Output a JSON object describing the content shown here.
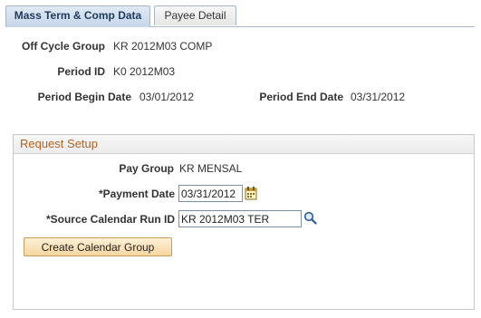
{
  "tabs": [
    {
      "label": "Mass Term & Comp Data",
      "active": true
    },
    {
      "label": "Payee Detail",
      "active": false
    }
  ],
  "header": {
    "off_cycle_group_label": "Off Cycle Group",
    "off_cycle_group_value": "KR 2012M03 COMP",
    "period_id_label": "Period ID",
    "period_id_value": "K0 2012M03",
    "period_begin_label": "Period Begin Date",
    "period_begin_value": "03/01/2012",
    "period_end_label": "Period End Date",
    "period_end_value": "03/31/2012"
  },
  "request_setup": {
    "title": "Request Setup",
    "pay_group_label": "Pay Group",
    "pay_group_value": "KR MENSAL",
    "payment_date_label": "*Payment Date",
    "payment_date_value": "03/31/2012",
    "source_calendar_label": "*Source Calendar Run ID",
    "source_calendar_value": "KR 2012M03 TER",
    "create_button_label": "Create Calendar Group"
  },
  "colors": {
    "accent": "#b4621c",
    "tab_active_bg": "#c6d7ea",
    "button_bg": "#f6d6a0"
  },
  "icons": {
    "calendar": "calendar-icon",
    "lookup": "magnifier-icon"
  }
}
